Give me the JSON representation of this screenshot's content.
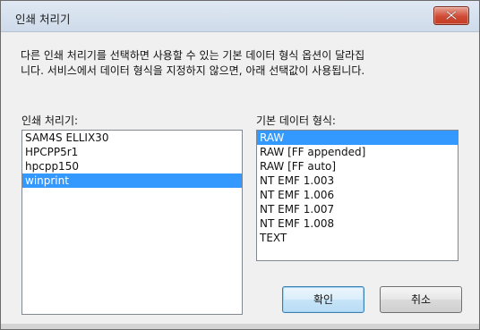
{
  "window": {
    "title": "인쇄 처리기",
    "close_label": "X"
  },
  "description": {
    "line1": "다른 인쇄 처리기를 선택하면 사용할 수 있는 기본 데이터 형식 옵션이 달라집",
    "line2": "니다. 서비스에서 데이터 형식을 지정하지 않으면, 아래 선택값이 사용됩니다."
  },
  "processors": {
    "label": "인쇄 처리기:",
    "items": [
      "SAM4S ELLIX30",
      "HPCPP5r1",
      "hpcpp150",
      "winprint"
    ],
    "selected": "winprint"
  },
  "datatypes": {
    "label": "기본 데이터 형식:",
    "items": [
      "RAW",
      "RAW [FF appended]",
      "RAW [FF auto]",
      "NT EMF 1.003",
      "NT EMF 1.006",
      "NT EMF 1.007",
      "NT EMF 1.008",
      "TEXT"
    ],
    "selected": "RAW"
  },
  "buttons": {
    "ok": "확인",
    "cancel": "취소"
  },
  "colors": {
    "selection": "#3399ff",
    "close_button": "#c43a22"
  }
}
